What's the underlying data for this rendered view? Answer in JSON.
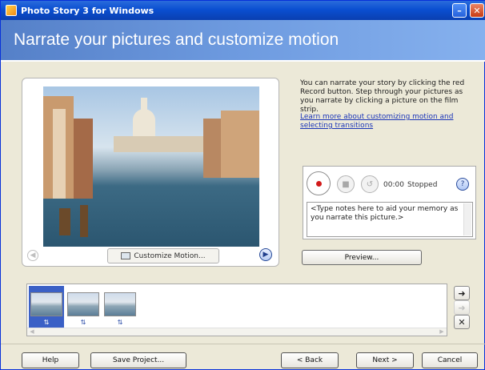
{
  "window": {
    "title": "Photo Story 3 for Windows"
  },
  "banner": {
    "heading": "Narrate your pictures and customize motion"
  },
  "preview": {
    "customize_label": "Customize Motion..."
  },
  "instructions": {
    "text": "You can narrate your story by clicking the red Record button. Step through your pictures as you narrate by clicking a picture on the film strip.",
    "learn_more": "Learn more about customizing motion and selecting transitions"
  },
  "narration": {
    "time": "00:00",
    "status": "Stopped",
    "notes": "<Type notes here to aid your memory as you narrate this picture.>"
  },
  "preview_button": "Preview...",
  "filmstrip": {
    "thumbnails": [
      {
        "selected": true
      },
      {
        "selected": false
      },
      {
        "selected": false
      }
    ]
  },
  "footer": {
    "help": "Help",
    "save_project": "Save Project...",
    "back": "< Back",
    "next": "Next >",
    "cancel": "Cancel"
  }
}
